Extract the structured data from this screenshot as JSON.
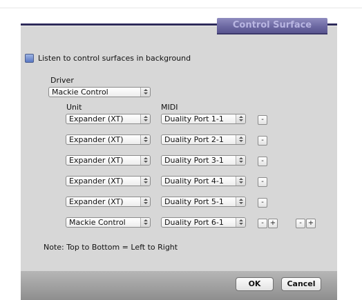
{
  "dialog": {
    "title": "Control Surface",
    "listen_label": "Listen to control surfaces in background",
    "driver_label": "Driver",
    "driver_value": "Mackie Control",
    "unit_header": "Unit",
    "midi_header": "MIDI",
    "rows": [
      {
        "unit": "Expander (XT)",
        "midi": "Duality Port 1-1",
        "remove": "-"
      },
      {
        "unit": "Expander (XT)",
        "midi": "Duality Port 2-1",
        "remove": "-"
      },
      {
        "unit": "Expander (XT)",
        "midi": "Duality Port 3-1",
        "remove": "-"
      },
      {
        "unit": "Expander (XT)",
        "midi": "Duality Port 4-1",
        "remove": "-"
      },
      {
        "unit": "Expander (XT)",
        "midi": "Duality Port 5-1",
        "remove": "-"
      },
      {
        "unit": "Mackie Control",
        "midi": "Duality Port 6-1",
        "remove": "-",
        "add": "+"
      }
    ],
    "extra_remove": "-",
    "extra_add": "+",
    "note": "Note: Top to Bottom = Left to Right",
    "ok_label": "OK",
    "cancel_label": "Cancel"
  }
}
